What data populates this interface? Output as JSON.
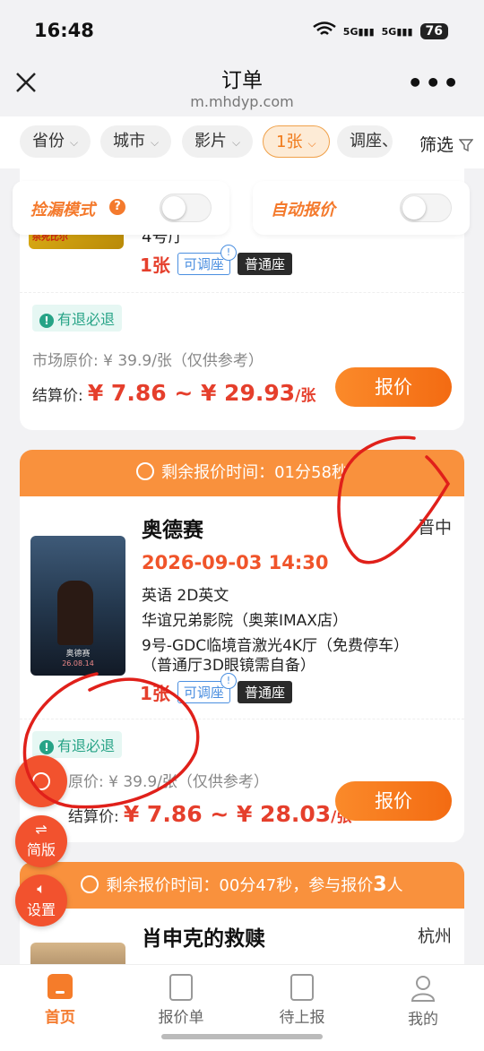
{
  "status_bar": {
    "time": "16:48",
    "signal1": "5G",
    "signal2": "5G",
    "battery": "76"
  },
  "header": {
    "title": "订单",
    "url": "m.mhdyp.com"
  },
  "filters": {
    "chips": [
      {
        "label": "省份"
      },
      {
        "label": "城市"
      },
      {
        "label": "影片"
      },
      {
        "label": "1张"
      },
      {
        "label": "调座、"
      }
    ],
    "filter_label": "筛选"
  },
  "toggles": {
    "pick_mode": "捡漏模式",
    "auto_quote": "自动报价"
  },
  "order1": {
    "poster_text_a": "杀死比尔",
    "hall": "4号厅",
    "qty": "1张",
    "adjust_tag": "可调座",
    "seat_tag": "普通座",
    "refund": "有退必退",
    "market_price": "市场原价: ¥ 39.9/张（仅供参考）",
    "settle_label": "结算价:",
    "settle_value": "¥ 7.86 ~ ¥ 29.93",
    "settle_unit": "/张",
    "quote_btn": "报价"
  },
  "order2": {
    "timer": "剩余报价时间：01分58秒",
    "title": "奥德赛",
    "city": "晋中",
    "showtime": "2026-09-03 14:30",
    "language": "英语 2D英文",
    "cinema": "华谊兄弟影院（奥莱IMAX店）",
    "hall_line1": "9号-GDC临境音激光4K厅（免费停车）",
    "hall_line2": "（普通厅3D眼镜需自备）",
    "poster_title": "奥德赛",
    "poster_date": "26.08.14",
    "qty": "1张",
    "adjust_tag": "可调座",
    "seat_tag": "普通座",
    "refund": "有退必退",
    "market_price": "原价: ¥ 39.9/张（仅供参考）",
    "settle_label": "结算价:",
    "settle_value": "¥ 7.86 ~ ¥ 28.03",
    "settle_unit": "/张",
    "quote_btn": "报价"
  },
  "order3": {
    "timer_prefix": "剩余报价时间：00分47秒，参与报价",
    "timer_count": "3",
    "timer_suffix": "人",
    "title": "肖申克的救赎",
    "city": "杭州"
  },
  "floating": {
    "simple": "简版",
    "settings": "设置"
  },
  "bottom_nav": {
    "home": "首页",
    "quotes": "报价单",
    "pending": "待上报",
    "mine": "我的"
  },
  "colors": {
    "accent": "#f47a2d",
    "price_red": "#e53f2c",
    "refund_green": "#26a386",
    "tag_blue": "#4b8fe0"
  }
}
